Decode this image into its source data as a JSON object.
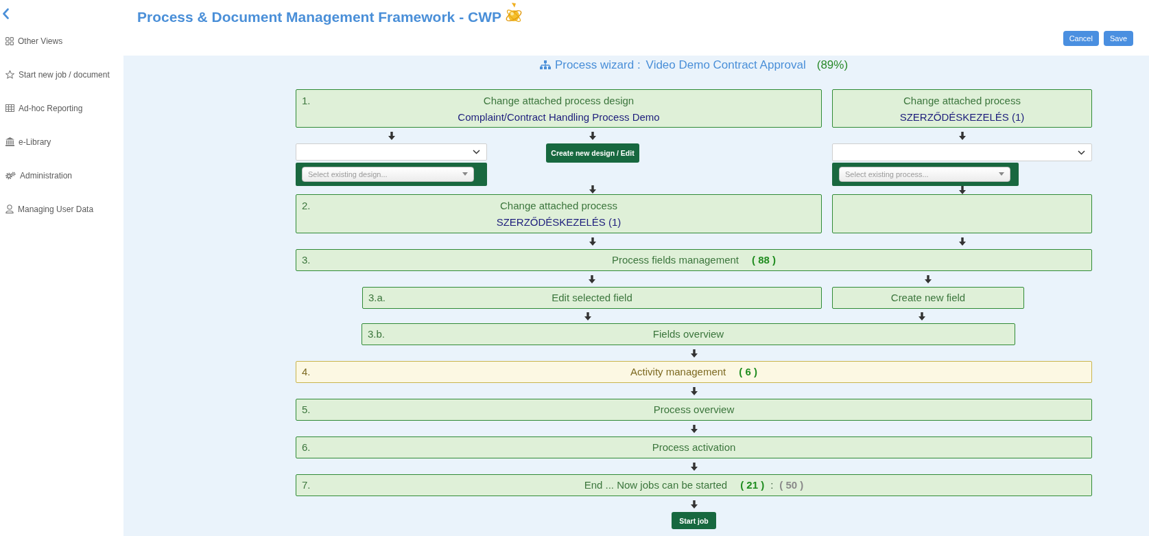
{
  "sidebar": {
    "items": [
      {
        "label": "Other Views"
      },
      {
        "label": "Start new job / document"
      },
      {
        "label": "Ad-hoc Reporting"
      },
      {
        "label": "e-Library"
      },
      {
        "label": "Administration"
      },
      {
        "label": "Managing User Data"
      }
    ]
  },
  "header": {
    "title": "Process & Document Management Framework - CWP",
    "buttons": [
      {
        "label": "Cancel"
      },
      {
        "label": "Save"
      }
    ]
  },
  "wizard": {
    "label": "Process wizard :",
    "name": "Video Demo Contract Approval",
    "progress": "(89%)",
    "design_step": {
      "number": "1.",
      "title": "Change attached process design",
      "value": "Complaint/Contract Handling Process Demo",
      "highlighted": false
    },
    "process_card": {
      "title": "Change attached process",
      "value": "SZERZŐDÉSKEZELÉS (1)",
      "highlighted": false
    },
    "design_select": {
      "placeholder": "Select existing design..."
    },
    "design_button": {
      "label": "Create new design / Edit"
    },
    "process_select": {
      "placeholder": "Select existing process..."
    },
    "process_step": {
      "number": "2.",
      "title": "Change attached process",
      "value": "SZERZŐDÉSKEZELÉS (1)",
      "highlighted": false
    },
    "fields_step": {
      "number": "3.",
      "title": "Process fields management",
      "counts": [
        {
          "text": "( 88 )",
          "kind": "active"
        }
      ],
      "highlighted": false
    },
    "edit_field_step": {
      "number": "3.a.",
      "title": "Edit selected field",
      "highlighted": false
    },
    "create_field": {
      "title": "Create new field",
      "highlighted": false
    },
    "fields_overview": {
      "number": "3.b.",
      "title": "Fields overview",
      "highlighted": false
    },
    "steps": [
      {
        "number": "4.",
        "title": "Activity management",
        "counts": [
          {
            "text": "( 6 )",
            "kind": "active"
          }
        ],
        "highlighted": true
      },
      {
        "number": "5.",
        "title": "Process overview",
        "highlighted": false
      },
      {
        "number": "6.",
        "title": "Process activation",
        "highlighted": false
      },
      {
        "number": "7.",
        "title": "End ... Now jobs can be started",
        "counts": [
          {
            "text": "( 21 )",
            "kind": "active"
          },
          {
            "text": ":",
            "kind": "separator"
          },
          {
            "text": "( 50 )",
            "kind": "total"
          }
        ],
        "highlighted": false
      }
    ],
    "start_button": {
      "label": "Start job"
    }
  }
}
